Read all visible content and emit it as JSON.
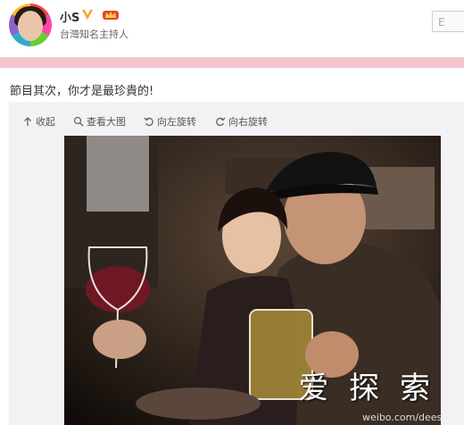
{
  "profile": {
    "name": "小S",
    "bio": "台灣知名主持人",
    "follow_label": "E"
  },
  "post": {
    "text": "節目其次，你才是最珍貴的!"
  },
  "toolbar": {
    "collapse_label": "收起",
    "view_large_label": "查看大图",
    "rotate_left_label": "向左旋转",
    "rotate_right_label": "向右旋转"
  },
  "photo": {
    "watermark_text": "爱 探 索",
    "watermark_url": "weibo.com/dees"
  },
  "colors": {
    "pink_bar": "#f5c6cf",
    "verified": "#f5a623",
    "vip": "#e8432a"
  }
}
